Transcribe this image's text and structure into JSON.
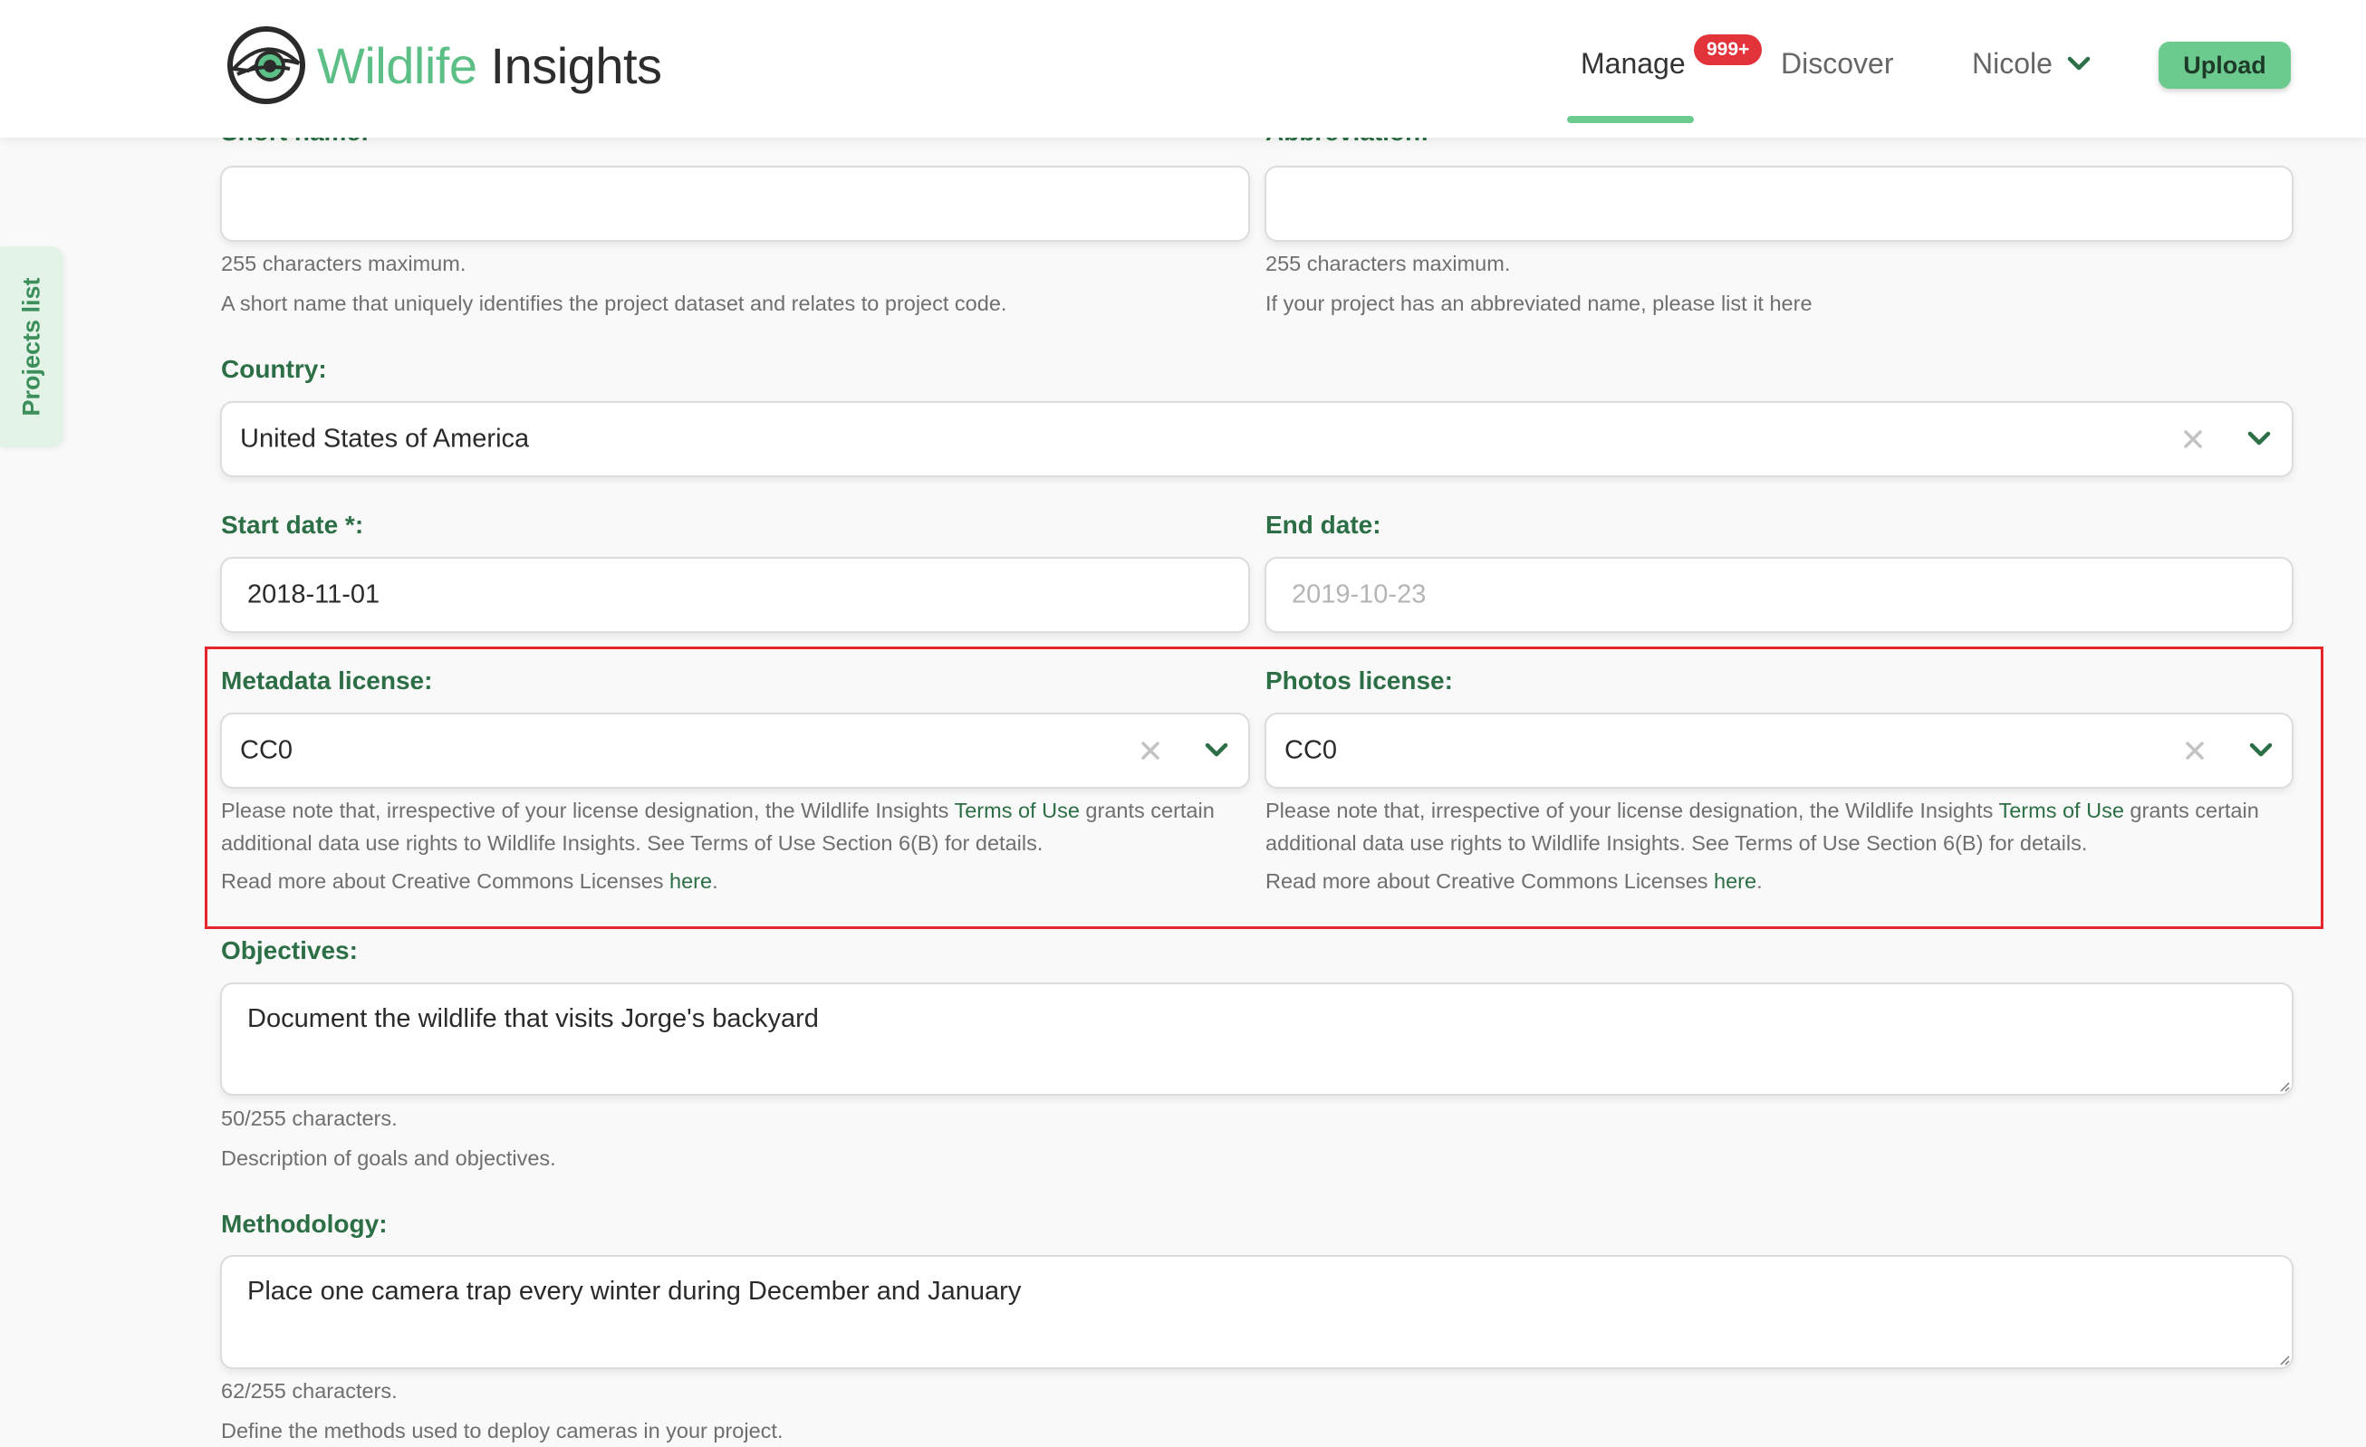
{
  "header": {
    "logo": {
      "part1": "Wildlife",
      "part2": " Insights"
    },
    "nav": {
      "manage": "Manage",
      "badge": "999+",
      "discover": "Discover",
      "user": "Nicole",
      "upload": "Upload"
    }
  },
  "side_tab": {
    "label": "Projects list"
  },
  "form": {
    "short_name": {
      "label": "Short name:",
      "value": "",
      "help1": "255 characters maximum.",
      "help2": "A short name that uniquely identifies the project dataset and relates to project code."
    },
    "abbreviation": {
      "label": "Abbreviation:",
      "value": "",
      "help1": "255 characters maximum.",
      "help2": "If your project has an abbreviated name, please list it here"
    },
    "country": {
      "label": "Country:",
      "value": "United States of America"
    },
    "start_date": {
      "label": "Start date *:",
      "value": "2018-11-01"
    },
    "end_date": {
      "label": "End date:",
      "placeholder": "2019-10-23"
    },
    "metadata_license": {
      "label": "Metadata license:",
      "value": "CC0",
      "note_prefix": "Please note that, irrespective of your license designation, the Wildlife Insights ",
      "terms_link": "Terms of Use",
      "note_suffix": " grants certain",
      "note_line2": "additional data use rights to Wildlife Insights. See Terms of Use Section 6(B) for details.",
      "read_more": "Read more about Creative Commons Licenses ",
      "here_link": "here",
      "period": "."
    },
    "photos_license": {
      "label": "Photos license:",
      "value": "CC0",
      "note_prefix": "Please note that, irrespective of your license designation, the Wildlife Insights ",
      "terms_link": "Terms of Use",
      "note_suffix": " grants certain",
      "note_line2": "additional data use rights to Wildlife Insights. See Terms of Use Section 6(B) for details.",
      "read_more": "Read more about Creative Commons Licenses ",
      "here_link": "here",
      "period": "."
    },
    "objectives": {
      "label": "Objectives:",
      "value": "Document the wildlife that visits Jorge's backyard",
      "count": "50/255 characters.",
      "help": "Description of goals and objectives."
    },
    "methodology": {
      "label": "Methodology:",
      "value": "Place one camera trap every winter during December and January",
      "count": "62/255 characters.",
      "help": "Define the methods used to deploy cameras in your project."
    }
  },
  "colors": {
    "brand_green": "#5bbf86",
    "label_green": "#2c6e45",
    "upload_button": "#6dca8f",
    "badge_red": "#e2333b",
    "highlight_red": "#e5262c"
  },
  "icons": [
    "logo-eye-icon",
    "chevron-down-icon",
    "clear-x-icon",
    "resize-handle-icon"
  ]
}
